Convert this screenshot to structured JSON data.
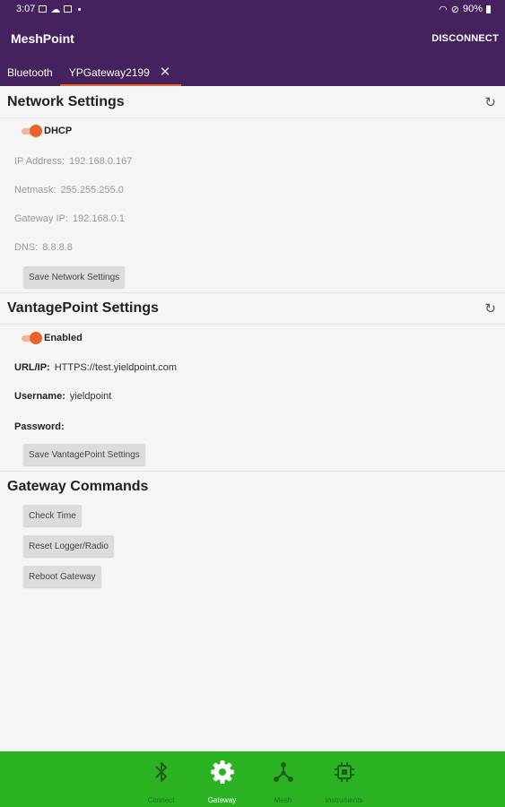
{
  "status_bar": {
    "time": "3:07",
    "battery": "90%"
  },
  "app": {
    "title": "MeshPoint",
    "disconnect_label": "DISCONNECT"
  },
  "tabs": [
    {
      "label": "Bluetooth"
    },
    {
      "label": "YPGateway2199",
      "close_glyph": "✕"
    }
  ],
  "network_settings": {
    "title": "Network Settings",
    "dhcp_label": "DHCP",
    "dhcp_on": true,
    "fields": [
      {
        "label": "IP Address:",
        "value": "192.168.0.167"
      },
      {
        "label": "Netmask:",
        "value": "255.255.255.0"
      },
      {
        "label": "Gateway IP:",
        "value": "192.168.0.1"
      },
      {
        "label": "DNS:",
        "value": "8.8.8.8"
      }
    ],
    "save_label": "Save Network Settings"
  },
  "vantagepoint_settings": {
    "title": "VantagePoint Settings",
    "enabled_label": "Enabled",
    "enabled_on": true,
    "fields": [
      {
        "label": "URL/IP:",
        "value": "HTTPS://test.yieldpoint.com"
      },
      {
        "label": "Username:",
        "value": "yieldpoint"
      },
      {
        "label": "Password:",
        "value": ""
      }
    ],
    "save_label": "Save VantagePoint Settings"
  },
  "gateway_commands": {
    "title": "Gateway Commands",
    "buttons": [
      {
        "label": "Check Time"
      },
      {
        "label": "Reset Logger/Radio"
      },
      {
        "label": "Reboot Gateway"
      }
    ]
  },
  "bottom_nav": {
    "items": [
      {
        "label": "Connect",
        "icon": "bluetooth-icon"
      },
      {
        "label": "Gateway",
        "icon": "gear-icon",
        "active": true
      },
      {
        "label": "Mesh",
        "icon": "mesh-icon"
      },
      {
        "label": "Instruments",
        "icon": "chip-icon"
      }
    ]
  },
  "colors": {
    "header": "#45215e",
    "accent": "#e8632a",
    "bottom_nav": "#2bb324"
  }
}
